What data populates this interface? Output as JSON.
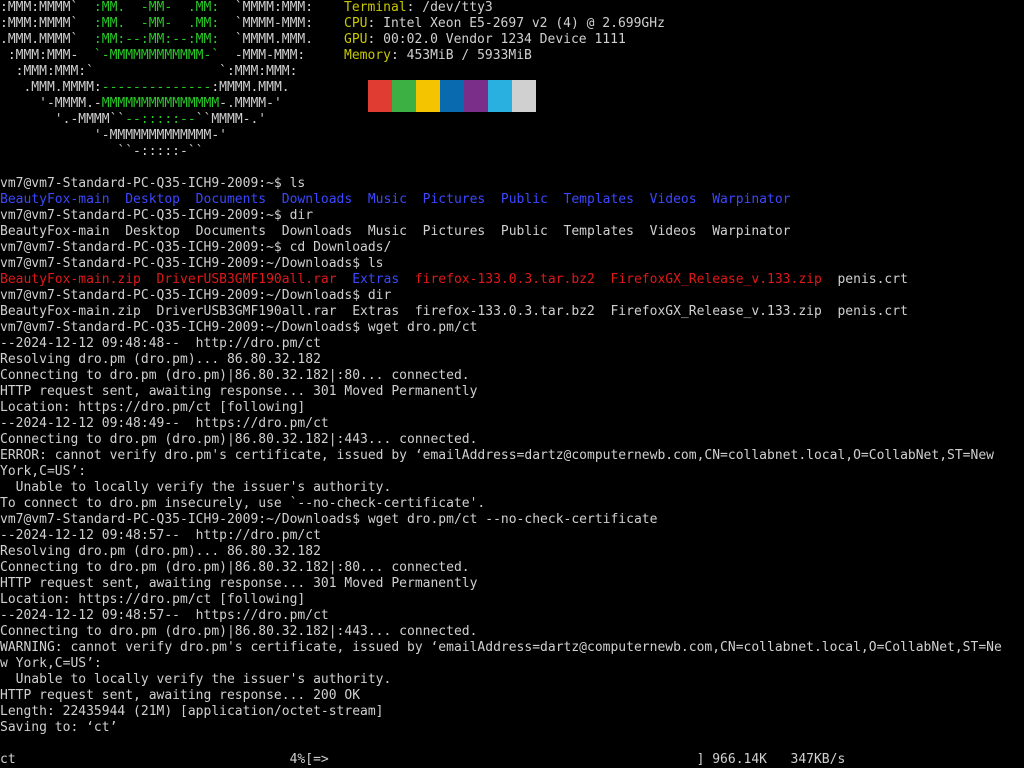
{
  "ascii_art": [
    [
      {
        "t": ":MMM:MMMM`  ",
        "c": "w"
      },
      {
        "t": ":MM.  -MM-  .MM:  ",
        "c": "g"
      },
      {
        "t": "`MMMM:MMM:",
        "c": "w"
      }
    ],
    [
      {
        "t": ":MMM:MMMM`  ",
        "c": "w"
      },
      {
        "t": ":MM.  -MM-  .MM:  ",
        "c": "g"
      },
      {
        "t": "`MMMM-MMM:",
        "c": "w"
      }
    ],
    [
      {
        "t": ".MMM.MMMM`  ",
        "c": "w"
      },
      {
        "t": ":MM:--:MM:--:MM:  ",
        "c": "g"
      },
      {
        "t": "`MMMM.MMM.",
        "c": "w"
      }
    ],
    [
      {
        "t": " :MMM:MMM-  ",
        "c": "w"
      },
      {
        "t": "`-MMMMMMMMMMMM-`  ",
        "c": "g"
      },
      {
        "t": "-MMM-MMM:",
        "c": "w"
      }
    ],
    [
      {
        "t": "  :MMM:MMM:`",
        "c": "w"
      },
      {
        "t": "                ",
        "c": "g"
      },
      {
        "t": "`:MMM:MMM:",
        "c": "w"
      }
    ],
    [
      {
        "t": "   .MMM.MMMM:",
        "c": "w"
      },
      {
        "t": "--------------",
        "c": "g"
      },
      {
        "t": ":MMMM.MMM.",
        "c": "w"
      }
    ],
    [
      {
        "t": "     '-MMMM.-",
        "c": "w"
      },
      {
        "t": "MMMMMMMMMMMMMMM",
        "c": "g"
      },
      {
        "t": "-.MMMM-'",
        "c": "w"
      }
    ],
    [
      {
        "t": "       '.-MMMM``",
        "c": "w"
      },
      {
        "t": "--:::::--",
        "c": "g"
      },
      {
        "t": "``MMMM-.'",
        "c": "w"
      }
    ],
    [
      {
        "t": "            '-MMMMMMMMMMMMM-'",
        "c": "w"
      }
    ],
    [
      {
        "t": "               ``-:::::-``",
        "c": "w"
      }
    ]
  ],
  "sysinfo": [
    {
      "key": "Terminal",
      "value": "/dev/tty3"
    },
    {
      "key": "CPU",
      "value": "Intel Xeon E5-2697 v2 (4) @ 2.699GHz"
    },
    {
      "key": "GPU",
      "value": "00:02.0 Vendor 1234 Device 1111"
    },
    {
      "key": "Memory",
      "value": "453MiB / 5933MiB"
    }
  ],
  "swatches": [
    "#e03c31",
    "#3cb043",
    "#f5c400",
    "#0a6ab0",
    "#7a2e8a",
    "#2ab0e0",
    "#d0d0d0"
  ],
  "lines": [
    [
      {
        "t": "vm7@vm7-Standard-PC-Q35-ICH9-2009:~$ ls",
        "c": "w"
      }
    ],
    [
      {
        "t": "BeautyFox-main  Desktop  Documents  Downloads  Music  Pictures  Public  Templates  Videos  Warpinator",
        "c": "b"
      }
    ],
    [
      {
        "t": "vm7@vm7-Standard-PC-Q35-ICH9-2009:~$ dir",
        "c": "w"
      }
    ],
    [
      {
        "t": "BeautyFox-main  Desktop  Documents  Downloads  Music  Pictures  Public  Templates  Videos  Warpinator",
        "c": "w"
      }
    ],
    [
      {
        "t": "vm7@vm7-Standard-PC-Q35-ICH9-2009:~$ cd Downloads/",
        "c": "w"
      }
    ],
    [
      {
        "t": "vm7@vm7-Standard-PC-Q35-ICH9-2009:~/Downloads$ ls",
        "c": "w"
      }
    ],
    [
      {
        "t": "BeautyFox-main.zip  DriverUSB3GMF190all.rar  ",
        "c": "r"
      },
      {
        "t": "Extras",
        "c": "b"
      },
      {
        "t": "  firefox-133.0.3.tar.bz2  FirefoxGX_Release_v.133.zip  ",
        "c": "r"
      },
      {
        "t": "penis.crt",
        "c": "w"
      }
    ],
    [
      {
        "t": "vm7@vm7-Standard-PC-Q35-ICH9-2009:~/Downloads$ dir",
        "c": "w"
      }
    ],
    [
      {
        "t": "BeautyFox-main.zip  DriverUSB3GMF190all.rar  Extras  firefox-133.0.3.tar.bz2  FirefoxGX_Release_v.133.zip  penis.crt",
        "c": "w"
      }
    ],
    [
      {
        "t": "vm7@vm7-Standard-PC-Q35-ICH9-2009:~/Downloads$ wget dro.pm/ct",
        "c": "w"
      }
    ],
    [
      {
        "t": "--2024-12-12 09:48:48--  http://dro.pm/ct",
        "c": "w"
      }
    ],
    [
      {
        "t": "Resolving dro.pm (dro.pm)... 86.80.32.182",
        "c": "w"
      }
    ],
    [
      {
        "t": "Connecting to dro.pm (dro.pm)|86.80.32.182|:80... connected.",
        "c": "w"
      }
    ],
    [
      {
        "t": "HTTP request sent, awaiting response... 301 Moved Permanently",
        "c": "w"
      }
    ],
    [
      {
        "t": "Location: https://dro.pm/ct [following]",
        "c": "w"
      }
    ],
    [
      {
        "t": "--2024-12-12 09:48:49--  https://dro.pm/ct",
        "c": "w"
      }
    ],
    [
      {
        "t": "Connecting to dro.pm (dro.pm)|86.80.32.182|:443... connected.",
        "c": "w"
      }
    ],
    [
      {
        "t": "ERROR: cannot verify dro.pm's certificate, issued by ‘emailAddress=dartz@computernewb.com,CN=collabnet.local,O=CollabNet,ST=New",
        "c": "w"
      }
    ],
    [
      {
        "t": "York,C=US’:",
        "c": "w"
      }
    ],
    [
      {
        "t": "  Unable to locally verify the issuer's authority.",
        "c": "w"
      }
    ],
    [
      {
        "t": "To connect to dro.pm insecurely, use `--no-check-certificate'.",
        "c": "w"
      }
    ],
    [
      {
        "t": "vm7@vm7-Standard-PC-Q35-ICH9-2009:~/Downloads$ wget dro.pm/ct --no-check-certificate",
        "c": "w"
      }
    ],
    [
      {
        "t": "--2024-12-12 09:48:57--  http://dro.pm/ct",
        "c": "w"
      }
    ],
    [
      {
        "t": "Resolving dro.pm (dro.pm)... 86.80.32.182",
        "c": "w"
      }
    ],
    [
      {
        "t": "Connecting to dro.pm (dro.pm)|86.80.32.182|:80... connected.",
        "c": "w"
      }
    ],
    [
      {
        "t": "HTTP request sent, awaiting response... 301 Moved Permanently",
        "c": "w"
      }
    ],
    [
      {
        "t": "Location: https://dro.pm/ct [following]",
        "c": "w"
      }
    ],
    [
      {
        "t": "--2024-12-12 09:48:57--  https://dro.pm/ct",
        "c": "w"
      }
    ],
    [
      {
        "t": "Connecting to dro.pm (dro.pm)|86.80.32.182|:443... connected.",
        "c": "w"
      }
    ],
    [
      {
        "t": "WARNING: cannot verify dro.pm's certificate, issued by ‘emailAddress=dartz@computernewb.com,CN=collabnet.local,O=CollabNet,ST=Ne",
        "c": "w"
      }
    ],
    [
      {
        "t": "w York,C=US’:",
        "c": "w"
      }
    ],
    [
      {
        "t": "  Unable to locally verify the issuer's authority.",
        "c": "w"
      }
    ],
    [
      {
        "t": "HTTP request sent, awaiting response... 200 OK",
        "c": "w"
      }
    ],
    [
      {
        "t": "Length: 22435944 (21M) [application/octet-stream]",
        "c": "w"
      }
    ],
    [
      {
        "t": "Saving to: ‘ct’",
        "c": "w"
      }
    ],
    [
      {
        "t": "",
        "c": "w"
      }
    ],
    [
      {
        "t": "ct                                   4%[=>                                               ] 966.14K   347KB/s",
        "c": "w"
      }
    ]
  ]
}
